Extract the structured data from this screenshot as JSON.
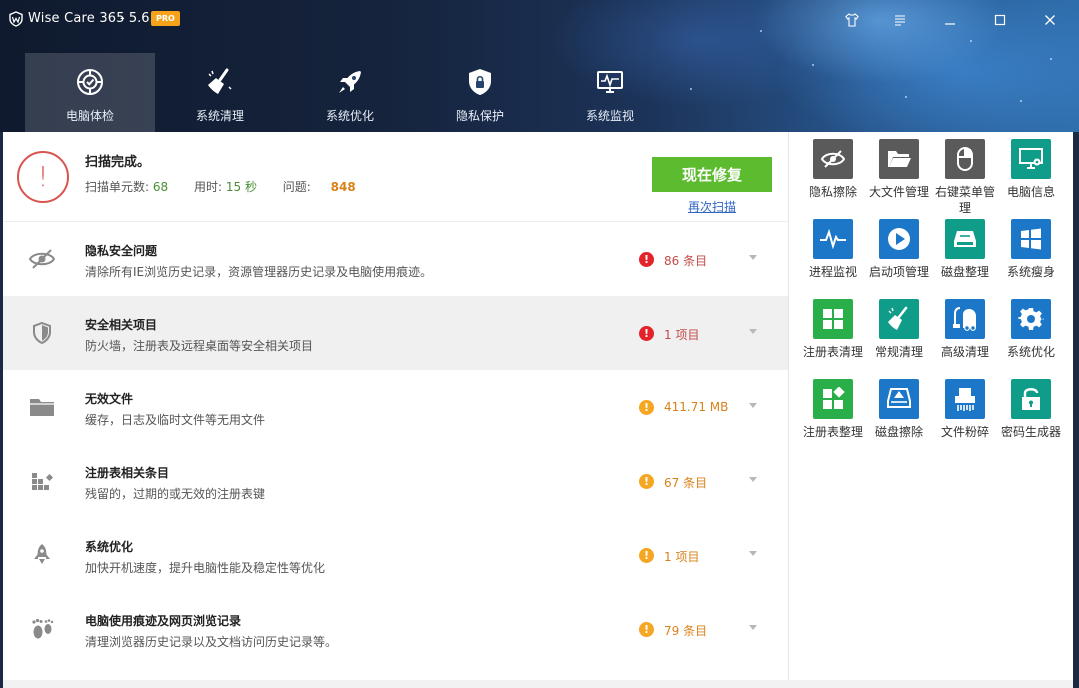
{
  "titlebar": {
    "title": "Wise Care 365",
    "version": "- 5.6.5",
    "badge": "PRO"
  },
  "nav": {
    "items": [
      {
        "label": "电脑体检",
        "icon": "checkup-icon",
        "active": true
      },
      {
        "label": "系统清理",
        "icon": "broom-icon",
        "active": false
      },
      {
        "label": "系统优化",
        "icon": "rocket-icon",
        "active": false
      },
      {
        "label": "隐私保护",
        "icon": "shield-lock-icon",
        "active": false
      },
      {
        "label": "系统监视",
        "icon": "monitor-icon",
        "active": false
      }
    ]
  },
  "summary": {
    "title": "扫描完成。",
    "units_label": "扫描单元数:",
    "units_value": "68",
    "time_label": "用时:",
    "time_value": "15 秒",
    "issues_label": "问题:",
    "issues_value": "848",
    "fix_button": "现在修复",
    "rescan": "再次扫描"
  },
  "rows": [
    {
      "title": "隐私安全问题",
      "desc": "清除所有IE浏览历史记录，资源管理器历史记录及电脑使用痕迹。",
      "count": "86 条目",
      "level": "red",
      "icon": "eye-slash-icon"
    },
    {
      "title": "安全相关项目",
      "desc": "防火墙，注册表及远程桌面等安全相关项目",
      "count": "1 项目",
      "level": "red",
      "icon": "shield-icon"
    },
    {
      "title": "无效文件",
      "desc": "缓存，日志及临时文件等无用文件",
      "count": "411.71 MB",
      "level": "orange",
      "icon": "folder-icon"
    },
    {
      "title": "注册表相关条目",
      "desc": "残留的，过期的或无效的注册表键",
      "count": "67 条目",
      "level": "orange",
      "icon": "registry-blocks-icon"
    },
    {
      "title": "系统优化",
      "desc": "加快开机速度，提升电脑性能及稳定性等优化",
      "count": "1 项目",
      "level": "orange",
      "icon": "rocket-icon"
    },
    {
      "title": "电脑使用痕迹及网页浏览记录",
      "desc": "清理浏览器历史记录以及文档访问历史记录等。",
      "count": "79 条目",
      "level": "orange",
      "icon": "footprints-icon"
    }
  ],
  "tools": [
    {
      "label": "隐私擦除",
      "icon": "eye-slash-icon",
      "color": "gray"
    },
    {
      "label": "大文件管理",
      "icon": "folder-open-icon",
      "color": "gray"
    },
    {
      "label": "右键菜单管理",
      "icon": "mouse-icon",
      "color": "gray"
    },
    {
      "label": "电脑信息",
      "icon": "monitor-gear-icon",
      "color": "teal"
    },
    {
      "label": "进程监视",
      "icon": "pulse-icon",
      "color": "blue"
    },
    {
      "label": "启动项管理",
      "icon": "play-circle-icon",
      "color": "blue"
    },
    {
      "label": "磁盘整理",
      "icon": "disk-defrag-icon",
      "color": "teal"
    },
    {
      "label": "系统瘦身",
      "icon": "windows-icon",
      "color": "blue"
    },
    {
      "label": "注册表清理",
      "icon": "grid-icon",
      "color": "green"
    },
    {
      "label": "常规清理",
      "icon": "broom-icon",
      "color": "teal"
    },
    {
      "label": "高级清理",
      "icon": "vacuum-icon",
      "color": "blue"
    },
    {
      "label": "系统优化",
      "icon": "gear-icon",
      "color": "blue"
    },
    {
      "label": "注册表整理",
      "icon": "registry-defrag-icon",
      "color": "green"
    },
    {
      "label": "磁盘擦除",
      "icon": "disk-erase-icon",
      "color": "blue"
    },
    {
      "label": "文件粉碎",
      "icon": "shredder-icon",
      "color": "blue"
    },
    {
      "label": "密码生成器",
      "icon": "lock-icon",
      "color": "teal"
    }
  ]
}
